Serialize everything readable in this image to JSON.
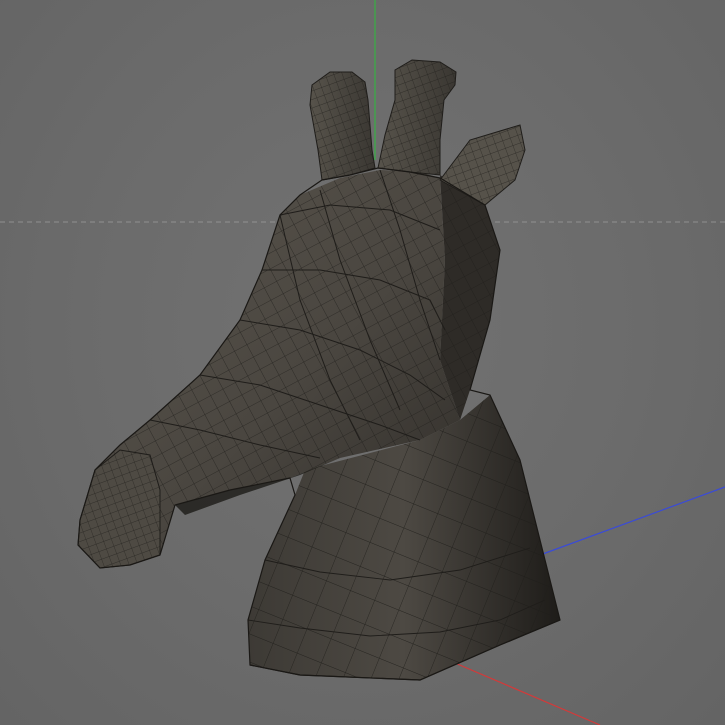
{
  "viewport": {
    "view": "perspective",
    "background_color": "#6b6b6b",
    "horizon_line_color": "#9a9a9a",
    "axes": {
      "x_color": "#d23a3a",
      "y_color": "#37b043",
      "z_color": "#3a4bd8"
    },
    "model": {
      "object": "giraffe-head",
      "display": "shaded-wireframe",
      "surface_color": "#4a4640",
      "wire_color": "#1f1d1a"
    }
  }
}
